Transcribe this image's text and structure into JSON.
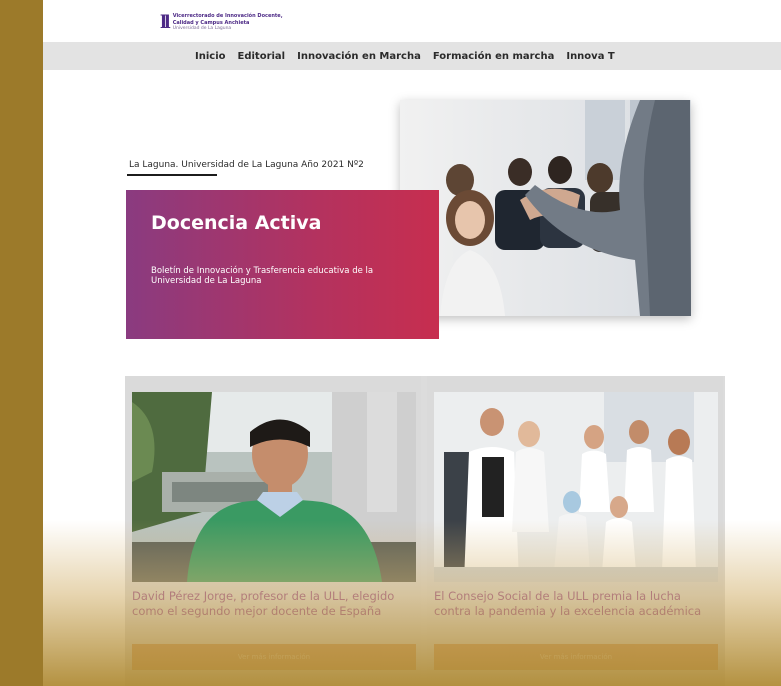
{
  "header": {
    "logo_mark": "ll",
    "logo_line1": "Vicerrectorado de Innovación Docente,",
    "logo_line2": "Calidad y Campus Anchieta",
    "logo_line3": "Universidad de La Laguna"
  },
  "nav": {
    "items": [
      {
        "label": "Inicio"
      },
      {
        "label": "Editorial"
      },
      {
        "label": "Innovación en Marcha"
      },
      {
        "label": "Formación en marcha"
      },
      {
        "label": "Innova T"
      }
    ]
  },
  "hero": {
    "kicker": "La Laguna. Universidad de La Laguna Año 2021 Nº2",
    "title": "Docencia Activa",
    "subtitle": "Boletín de Innovación y Trasferencia educativa de la Universidad de La Laguna"
  },
  "cards": [
    {
      "title": "David Pérez Jorge, profesor de la ULL, elegido como el segundo mejor docente de España",
      "button": "Ver más información"
    },
    {
      "title": "El Consejo Social de la ULL premia la lucha contra la pandemia y la excelencia académica",
      "button": "Ver más información"
    }
  ],
  "colors": {
    "side_bar": "#9c7a2a",
    "nav_bg": "#e3e3e3",
    "hero_gradient_start": "#8a3b80",
    "hero_gradient_end": "#c72e4f",
    "card_title": "#8a3d8c",
    "card_button": "#c77d3a"
  }
}
